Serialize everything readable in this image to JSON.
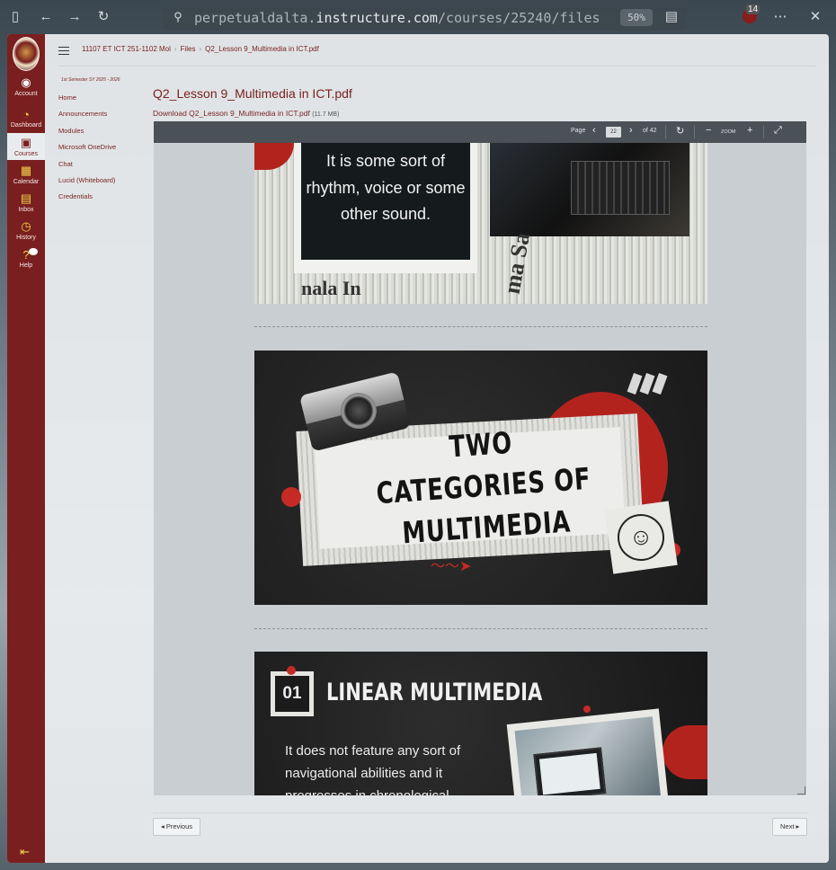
{
  "browser": {
    "url_prefix": "perpetualdalta.",
    "url_host": "instructure.com",
    "url_path": "/courses/25240/files",
    "zoom": "50%",
    "extension_count": "14"
  },
  "global_nav": {
    "items": [
      {
        "label": "Account"
      },
      {
        "label": "Dashboard"
      },
      {
        "label": "Courses"
      },
      {
        "label": "Calendar"
      },
      {
        "label": "Inbox"
      },
      {
        "label": "History"
      },
      {
        "label": "Help"
      }
    ]
  },
  "breadcrumb": {
    "course": "11107 ET ICT 251-1102 Mol",
    "section": "Files",
    "file": "Q2_Lesson 9_Multimedia in ICT.pdf"
  },
  "course_nav": {
    "term": "1st Semester SY 2025 - 2026",
    "links": [
      "Home",
      "Announcements",
      "Modules",
      "Microsoft OneDrive",
      "Chat",
      "Lucid (Whiteboard)",
      "Credentials"
    ]
  },
  "file": {
    "title": "Q2_Lesson 9_Multimedia in ICT.pdf",
    "download_label": "Download Q2_Lesson 9_Multimedia in ICT.pdf",
    "size": "(11.7 MB)"
  },
  "pdf_toolbar": {
    "page_label": "Page",
    "page_number": "22",
    "page_total": "of 42",
    "zoom_label": "ZOOM"
  },
  "slides": {
    "slide1_text": "It is some sort of rhythm, voice or some other sound.",
    "slide1_paper_word_a": "nala In",
    "slide1_paper_word_b": "ma Sa",
    "slide2_title": "TWO CATEGORIES OF MULTIMEDIA",
    "slide3_number": "01",
    "slide3_title": "LINEAR MULTIMEDIA",
    "slide3_body": "It does not feature any sort of navigational abilities and it progresses in chronological"
  },
  "pagination": {
    "previous": "◂ Previous",
    "next": "Next ▸"
  },
  "colors": {
    "brand": "#7a1f1f",
    "nav_icon": "#f2d34a",
    "slide_red": "#b3231e"
  }
}
